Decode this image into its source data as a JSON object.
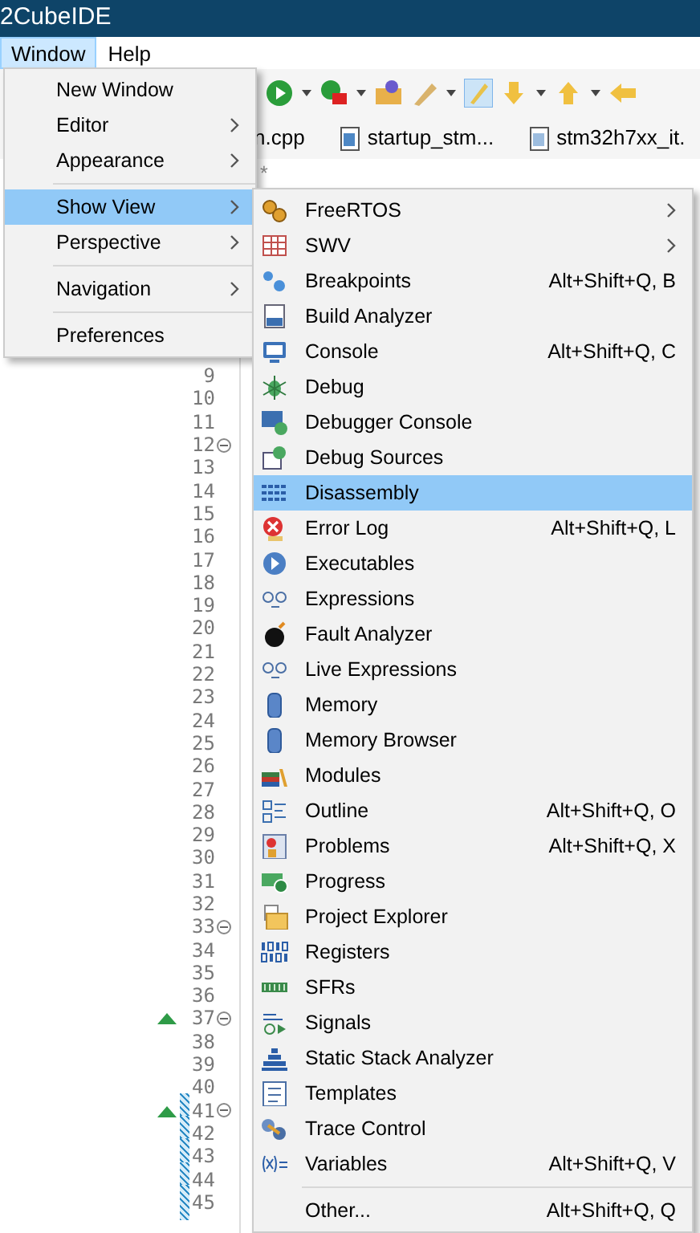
{
  "window": {
    "title": "2CubeIDE"
  },
  "menubar": [
    {
      "label": "Window",
      "selected": true
    },
    {
      "label": "Help",
      "selected": false
    }
  ],
  "editor_tabs": [
    {
      "label": "n.cpp",
      "kind": "cpp"
    },
    {
      "label": "startup_stm...",
      "kind": "asm"
    },
    {
      "label": "stm32h7xx_it.",
      "kind": "c"
    }
  ],
  "editor_fragment": "*",
  "line_numbers": [
    {
      "number": "9",
      "fold": false,
      "annotation": false,
      "highlight": false
    },
    {
      "number": "10",
      "fold": false,
      "annotation": false,
      "highlight": false
    },
    {
      "number": "11",
      "fold": false,
      "annotation": false,
      "highlight": false
    },
    {
      "number": "12",
      "fold": true,
      "annotation": false,
      "highlight": false
    },
    {
      "number": "13",
      "fold": false,
      "annotation": false,
      "highlight": false
    },
    {
      "number": "14",
      "fold": false,
      "annotation": false,
      "highlight": false
    },
    {
      "number": "15",
      "fold": false,
      "annotation": false,
      "highlight": false
    },
    {
      "number": "16",
      "fold": false,
      "annotation": false,
      "highlight": false
    },
    {
      "number": "17",
      "fold": false,
      "annotation": false,
      "highlight": false
    },
    {
      "number": "18",
      "fold": false,
      "annotation": false,
      "highlight": false
    },
    {
      "number": "19",
      "fold": false,
      "annotation": false,
      "highlight": false
    },
    {
      "number": "20",
      "fold": false,
      "annotation": false,
      "highlight": false
    },
    {
      "number": "21",
      "fold": false,
      "annotation": false,
      "highlight": false
    },
    {
      "number": "22",
      "fold": false,
      "annotation": false,
      "highlight": false
    },
    {
      "number": "23",
      "fold": false,
      "annotation": false,
      "highlight": false
    },
    {
      "number": "24",
      "fold": false,
      "annotation": false,
      "highlight": false
    },
    {
      "number": "25",
      "fold": false,
      "annotation": false,
      "highlight": false
    },
    {
      "number": "26",
      "fold": false,
      "annotation": false,
      "highlight": false
    },
    {
      "number": "27",
      "fold": false,
      "annotation": false,
      "highlight": false
    },
    {
      "number": "28",
      "fold": false,
      "annotation": false,
      "highlight": false
    },
    {
      "number": "29",
      "fold": false,
      "annotation": false,
      "highlight": false
    },
    {
      "number": "30",
      "fold": false,
      "annotation": false,
      "highlight": false
    },
    {
      "number": "31",
      "fold": false,
      "annotation": false,
      "highlight": false
    },
    {
      "number": "32",
      "fold": false,
      "annotation": false,
      "highlight": false
    },
    {
      "number": "33",
      "fold": true,
      "annotation": false,
      "highlight": false
    },
    {
      "number": "34",
      "fold": false,
      "annotation": false,
      "highlight": false
    },
    {
      "number": "35",
      "fold": false,
      "annotation": false,
      "highlight": false
    },
    {
      "number": "36",
      "fold": false,
      "annotation": false,
      "highlight": false
    },
    {
      "number": "37",
      "fold": true,
      "annotation": true,
      "highlight": false
    },
    {
      "number": "38",
      "fold": false,
      "annotation": false,
      "highlight": false
    },
    {
      "number": "39",
      "fold": false,
      "annotation": false,
      "highlight": false
    },
    {
      "number": "40",
      "fold": false,
      "annotation": false,
      "highlight": false
    },
    {
      "number": "41",
      "fold": true,
      "annotation": true,
      "highlight": true
    },
    {
      "number": "42",
      "fold": false,
      "annotation": false,
      "highlight": true
    },
    {
      "number": "43",
      "fold": false,
      "annotation": false,
      "highlight": true
    },
    {
      "number": "44",
      "fold": false,
      "annotation": false,
      "highlight": true
    },
    {
      "number": "45",
      "fold": false,
      "annotation": false,
      "highlight": true
    }
  ],
  "window_menu": [
    {
      "kind": "item",
      "label": "New Window",
      "submenu": false,
      "selected": false
    },
    {
      "kind": "item",
      "label": "Editor",
      "submenu": true,
      "selected": false
    },
    {
      "kind": "item",
      "label": "Appearance",
      "submenu": true,
      "selected": false
    },
    {
      "kind": "separator"
    },
    {
      "kind": "item",
      "label": "Show View",
      "submenu": true,
      "selected": true
    },
    {
      "kind": "item",
      "label": "Perspective",
      "submenu": true,
      "selected": false
    },
    {
      "kind": "separator"
    },
    {
      "kind": "item",
      "label": "Navigation",
      "submenu": true,
      "selected": false
    },
    {
      "kind": "separator"
    },
    {
      "kind": "item",
      "label": "Preferences",
      "submenu": false,
      "selected": false
    }
  ],
  "show_view_menu": [
    {
      "kind": "item",
      "label": "FreeRTOS",
      "submenu": true,
      "selected": false
    },
    {
      "kind": "item",
      "label": "SWV",
      "submenu": true,
      "selected": false
    },
    {
      "kind": "item",
      "label": "Breakpoints",
      "shortcut": "Alt+Shift+Q, B",
      "submenu": false,
      "selected": false
    },
    {
      "kind": "item",
      "label": "Build Analyzer",
      "submenu": false,
      "selected": false
    },
    {
      "kind": "item",
      "label": "Console",
      "shortcut": "Alt+Shift+Q, C",
      "submenu": false,
      "selected": false
    },
    {
      "kind": "item",
      "label": "Debug",
      "submenu": false,
      "selected": false
    },
    {
      "kind": "item",
      "label": "Debugger Console",
      "submenu": false,
      "selected": false
    },
    {
      "kind": "item",
      "label": "Debug Sources",
      "submenu": false,
      "selected": false
    },
    {
      "kind": "item",
      "label": "Disassembly",
      "submenu": false,
      "selected": true
    },
    {
      "kind": "item",
      "label": "Error Log",
      "shortcut": "Alt+Shift+Q, L",
      "submenu": false,
      "selected": false
    },
    {
      "kind": "item",
      "label": "Executables",
      "submenu": false,
      "selected": false
    },
    {
      "kind": "item",
      "label": "Expressions",
      "submenu": false,
      "selected": false
    },
    {
      "kind": "item",
      "label": "Fault Analyzer",
      "submenu": false,
      "selected": false
    },
    {
      "kind": "item",
      "label": "Live Expressions",
      "submenu": false,
      "selected": false
    },
    {
      "kind": "item",
      "label": "Memory",
      "submenu": false,
      "selected": false
    },
    {
      "kind": "item",
      "label": "Memory Browser",
      "submenu": false,
      "selected": false
    },
    {
      "kind": "item",
      "label": "Modules",
      "submenu": false,
      "selected": false
    },
    {
      "kind": "item",
      "label": "Outline",
      "shortcut": "Alt+Shift+Q, O",
      "submenu": false,
      "selected": false
    },
    {
      "kind": "item",
      "label": "Problems",
      "shortcut": "Alt+Shift+Q, X",
      "submenu": false,
      "selected": false
    },
    {
      "kind": "item",
      "label": "Progress",
      "submenu": false,
      "selected": false
    },
    {
      "kind": "item",
      "label": "Project Explorer",
      "submenu": false,
      "selected": false
    },
    {
      "kind": "item",
      "label": "Registers",
      "submenu": false,
      "selected": false
    },
    {
      "kind": "item",
      "label": "SFRs",
      "submenu": false,
      "selected": false
    },
    {
      "kind": "item",
      "label": "Signals",
      "submenu": false,
      "selected": false
    },
    {
      "kind": "item",
      "label": "Static Stack Analyzer",
      "submenu": false,
      "selected": false
    },
    {
      "kind": "item",
      "label": "Templates",
      "submenu": false,
      "selected": false
    },
    {
      "kind": "item",
      "label": "Trace Control",
      "submenu": false,
      "selected": false
    },
    {
      "kind": "item",
      "label": "Variables",
      "shortcut": "Alt+Shift+Q, V",
      "submenu": false,
      "selected": false
    },
    {
      "kind": "separator"
    },
    {
      "kind": "item",
      "label": "Other...",
      "shortcut": "Alt+Shift+Q, Q",
      "submenu": false,
      "selected": false
    }
  ]
}
